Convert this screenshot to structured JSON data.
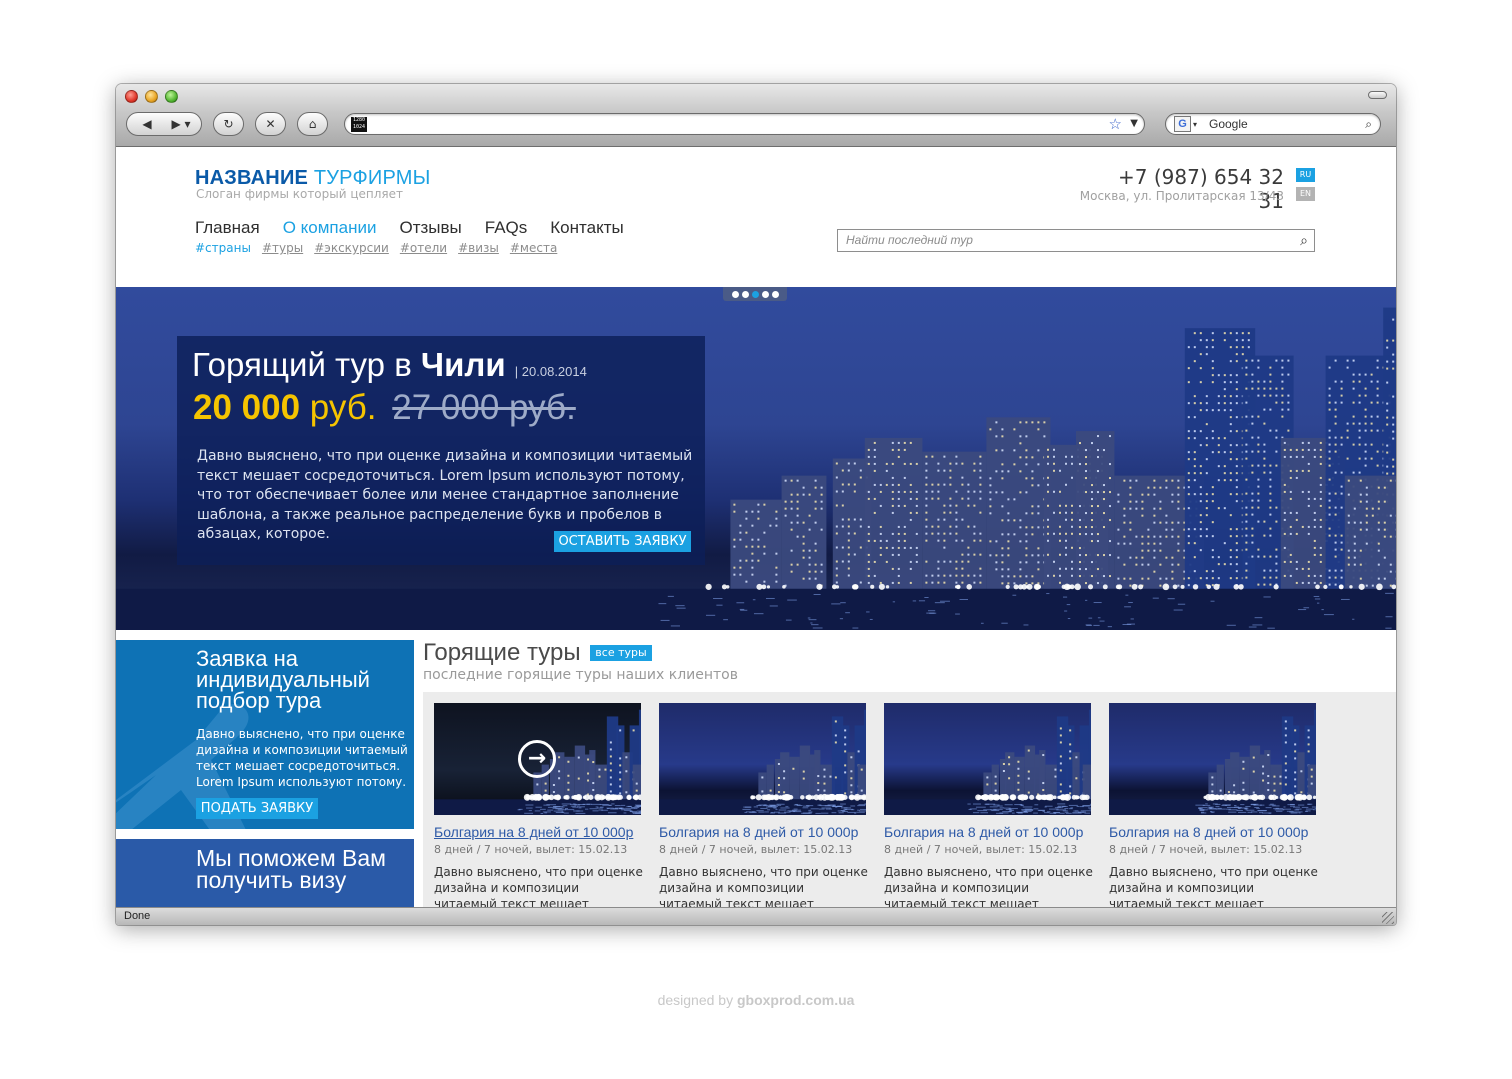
{
  "header": {
    "brand_bold": "НАЗВАНИЕ",
    "brand_light": "ТУРФИРМЫ",
    "slogan": "Слоган фирмы который цепляет",
    "phone": "+7 (987) 654 32 31",
    "address": "Москва, ул. Пролитарская 13/43",
    "lang_ru": "RU",
    "lang_en": "EN"
  },
  "browser": {
    "search_engine": "Google",
    "resolution_badge": "1280 1024",
    "status": "Done"
  },
  "nav": {
    "items": [
      "Главная",
      "О компании",
      "Отзывы",
      "FAQs",
      "Контакты"
    ],
    "tags": [
      "#страны",
      "#туры",
      "#экскурсии",
      "#отели",
      "#визы",
      "#места"
    ]
  },
  "search": {
    "placeholder": "Найти последний тур"
  },
  "hero": {
    "title_prefix": "Горящий тур в ",
    "title_country": "Чили",
    "date": "| 20.08.2014",
    "price": "20 000",
    "price_currency": "руб.",
    "old_price": "27 000 руб.",
    "text": "Давно выяснено, что при оценке дизайна и композиции читаемый текст мешает сосредоточиться. Lorem Ipsum используют потому, что тот обеспечивает более или менее стандартное заполнение шаблона, а также реальное распределение букв и пробелов в абзацах, которое.",
    "cta": "ОСТАВИТЬ ЗАЯВКУ",
    "slides_count": 5,
    "active_slide": 3
  },
  "apply": {
    "title": "Заявка на индивидуальный подбор тура",
    "text": "Давно выяснено, что при оценке дизайна и композиции читаемый текст мешает сосредоточиться. Lorem Ipsum используют потому.",
    "cta": "ПОДАТЬ ЗАЯВКУ"
  },
  "visa": {
    "title": "Мы поможем Вам получить визу"
  },
  "hot_tours": {
    "title": "Горящие туры",
    "all_label": "все туры",
    "subtitle": "последние горящие туры наших клиентов",
    "cards": [
      {
        "title": "Болгария на 8 дней от 10 000р",
        "meta": "8 дней / 7 ночей,  вылет: 15.02.13",
        "text": "Давно выяснено, что при оценке дизайна и композиции читаемый текст мешает сосредоточиться."
      },
      {
        "title": "Болгария на 8 дней от 10 000р",
        "meta": "8 дней / 7 ночей,  вылет: 15.02.13",
        "text": "Давно выяснено, что при оценке дизайна и композиции читаемый текст мешает сосредоточиться."
      },
      {
        "title": "Болгария на 8 дней от 10 000р",
        "meta": "8 дней / 7 ночей,  вылет: 15.02.13",
        "text": "Давно выяснено, что при оценке дизайна и композиции читаемый текст мешает сосредоточиться."
      },
      {
        "title": "Болгария на 8 дней от 10 000р",
        "meta": "8 дней / 7 ночей,  вылет: 15.02.13",
        "text": "Давно выяснено, что при оценке дизайна и композиции читаемый текст мешает сосредоточиться."
      }
    ]
  },
  "credit": {
    "prefix": "designed by ",
    "site": "gboxprod.com.ua"
  },
  "colors": {
    "accent": "#1ba1e2",
    "brand": "#0a5aa8",
    "apply_bg": "#0e72b5",
    "visa_bg": "#2a5aa8",
    "price": "#f5c400"
  }
}
